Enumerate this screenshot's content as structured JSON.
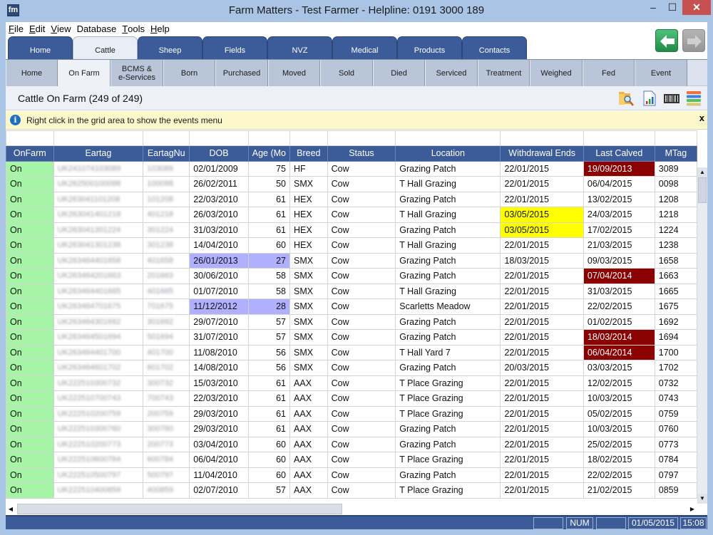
{
  "window": {
    "title": "Farm Matters - Test Farmer - Helpline: 0191 3000 189",
    "logo": "fm",
    "minimize_label": "–",
    "maximize_label": "☐",
    "close_label": "✕"
  },
  "menu": [
    {
      "label": "File",
      "accel": "F",
      "rest": "ile"
    },
    {
      "label": "Edit",
      "accel": "E",
      "rest": "dit"
    },
    {
      "label": "View",
      "accel": "V",
      "rest": "iew"
    },
    {
      "label": "Database",
      "accel": "",
      "rest": "Database"
    },
    {
      "label": "Tools",
      "accel": "T",
      "rest": "ools"
    },
    {
      "label": "Help",
      "accel": "H",
      "rest": "elp"
    }
  ],
  "main_tabs": [
    {
      "label": "Home",
      "active": false
    },
    {
      "label": "Cattle",
      "active": true
    },
    {
      "label": "Sheep",
      "active": false
    },
    {
      "label": "Fields",
      "active": false
    },
    {
      "label": "NVZ",
      "active": false
    },
    {
      "label": "Medical",
      "active": false
    },
    {
      "label": "Products",
      "active": false
    },
    {
      "label": "Contacts",
      "active": false
    }
  ],
  "nav": {
    "back_icon": "arrow-left-icon",
    "forward_icon": "arrow-right-icon"
  },
  "sub_tabs": [
    {
      "label": "Home",
      "active": false
    },
    {
      "label": "On Farm",
      "active": true
    },
    {
      "label": "BCMS &\ne-Services",
      "active": false
    },
    {
      "label": "Born",
      "active": false
    },
    {
      "label": "Purchased",
      "active": false
    },
    {
      "label": "Moved",
      "active": false
    },
    {
      "label": "Sold",
      "active": false
    },
    {
      "label": "Died",
      "active": false
    },
    {
      "label": "Serviced",
      "active": false
    },
    {
      "label": "Treatment",
      "active": false
    },
    {
      "label": "Weighed",
      "active": false
    },
    {
      "label": "Fed",
      "active": false
    },
    {
      "label": "Event",
      "active": false
    }
  ],
  "page": {
    "title": "Cattle On Farm (249 of 249)",
    "toolbar_icons": [
      "search-folder-icon",
      "report-chart-icon",
      "barcode-icon",
      "columns-list-icon"
    ]
  },
  "info": {
    "message": "Right click in the grid area to show the events menu",
    "close_label": "x"
  },
  "grid": {
    "columns": [
      "OnFarm",
      "Eartag",
      "EartagNu",
      "DOB",
      "Age (Mo",
      "Breed",
      "Status",
      "Location",
      "Withdrawal Ends",
      "Last Calved",
      "MTag"
    ],
    "rows": [
      {
        "onfarm": "On",
        "eartag": "UK241074103089",
        "eartagnu": "103089",
        "dob": "02/01/2009",
        "age": "75",
        "breed": "HF",
        "status": "Cow",
        "location": "Grazing Patch",
        "withdrawal": "22/01/2015",
        "calved": "19/09/2013",
        "mtag": "3089",
        "hl_dob": "",
        "hl_withdrawal": "",
        "hl_calved": "red"
      },
      {
        "onfarm": "On",
        "eartag": "UK262500100098",
        "eartagnu": "100098",
        "dob": "26/02/2011",
        "age": "50",
        "breed": "SMX",
        "status": "Cow",
        "location": "T Hall Grazing",
        "withdrawal": "22/01/2015",
        "calved": "06/04/2015",
        "mtag": "0098",
        "hl_dob": "",
        "hl_withdrawal": "",
        "hl_calved": ""
      },
      {
        "onfarm": "On",
        "eartag": "UK263041101208",
        "eartagnu": "101208",
        "dob": "22/03/2010",
        "age": "61",
        "breed": "HEX",
        "status": "Cow",
        "location": "Grazing Patch",
        "withdrawal": "22/01/2015",
        "calved": "13/02/2015",
        "mtag": "1208",
        "hl_dob": "",
        "hl_withdrawal": "",
        "hl_calved": ""
      },
      {
        "onfarm": "On",
        "eartag": "UK263041401218",
        "eartagnu": "401218",
        "dob": "26/03/2010",
        "age": "61",
        "breed": "HEX",
        "status": "Cow",
        "location": "T Hall Grazing",
        "withdrawal": "03/05/2015",
        "calved": "24/03/2015",
        "mtag": "1218",
        "hl_dob": "",
        "hl_withdrawal": "yellow",
        "hl_calved": ""
      },
      {
        "onfarm": "On",
        "eartag": "UK263041301224",
        "eartagnu": "301224",
        "dob": "31/03/2010",
        "age": "61",
        "breed": "HEX",
        "status": "Cow",
        "location": "Grazing Patch",
        "withdrawal": "03/05/2015",
        "calved": "17/02/2015",
        "mtag": "1224",
        "hl_dob": "",
        "hl_withdrawal": "yellow",
        "hl_calved": ""
      },
      {
        "onfarm": "On",
        "eartag": "UK263041301238",
        "eartagnu": "301238",
        "dob": "14/04/2010",
        "age": "60",
        "breed": "HEX",
        "status": "Cow",
        "location": "T Hall Grazing",
        "withdrawal": "22/01/2015",
        "calved": "21/03/2015",
        "mtag": "1238",
        "hl_dob": "",
        "hl_withdrawal": "",
        "hl_calved": ""
      },
      {
        "onfarm": "On",
        "eartag": "UK263464401658",
        "eartagnu": "401658",
        "dob": "26/01/2013",
        "age": "27",
        "breed": "SMX",
        "status": "Cow",
        "location": "Grazing Patch",
        "withdrawal": "18/03/2015",
        "calved": "09/03/2015",
        "mtag": "1658",
        "hl_dob": "purple",
        "hl_withdrawal": "",
        "hl_calved": ""
      },
      {
        "onfarm": "On",
        "eartag": "UK263464201663",
        "eartagnu": "201663",
        "dob": "30/06/2010",
        "age": "58",
        "breed": "SMX",
        "status": "Cow",
        "location": "Grazing Patch",
        "withdrawal": "22/01/2015",
        "calved": "07/04/2014",
        "mtag": "1663",
        "hl_dob": "",
        "hl_withdrawal": "",
        "hl_calved": "red"
      },
      {
        "onfarm": "On",
        "eartag": "UK263464401665",
        "eartagnu": "401665",
        "dob": "01/07/2010",
        "age": "58",
        "breed": "SMX",
        "status": "Cow",
        "location": "T Hall Grazing",
        "withdrawal": "22/01/2015",
        "calved": "31/03/2015",
        "mtag": "1665",
        "hl_dob": "",
        "hl_withdrawal": "",
        "hl_calved": ""
      },
      {
        "onfarm": "On",
        "eartag": "UK263464701675",
        "eartagnu": "701675",
        "dob": "11/12/2012",
        "age": "28",
        "breed": "SMX",
        "status": "Cow",
        "location": "Scarletts Meadow",
        "withdrawal": "22/01/2015",
        "calved": "22/02/2015",
        "mtag": "1675",
        "hl_dob": "purple",
        "hl_withdrawal": "",
        "hl_calved": ""
      },
      {
        "onfarm": "On",
        "eartag": "UK263464301692",
        "eartagnu": "301692",
        "dob": "29/07/2010",
        "age": "57",
        "breed": "SMX",
        "status": "Cow",
        "location": "Grazing Patch",
        "withdrawal": "22/01/2015",
        "calved": "01/02/2015",
        "mtag": "1692",
        "hl_dob": "",
        "hl_withdrawal": "",
        "hl_calved": ""
      },
      {
        "onfarm": "On",
        "eartag": "UK263464501694",
        "eartagnu": "501694",
        "dob": "31/07/2010",
        "age": "57",
        "breed": "SMX",
        "status": "Cow",
        "location": "Grazing Patch",
        "withdrawal": "22/01/2015",
        "calved": "18/03/2014",
        "mtag": "1694",
        "hl_dob": "",
        "hl_withdrawal": "",
        "hl_calved": "red"
      },
      {
        "onfarm": "On",
        "eartag": "UK263464401700",
        "eartagnu": "401700",
        "dob": "11/08/2010",
        "age": "56",
        "breed": "SMX",
        "status": "Cow",
        "location": "T Hall Yard 7",
        "withdrawal": "22/01/2015",
        "calved": "06/04/2014",
        "mtag": "1700",
        "hl_dob": "",
        "hl_withdrawal": "",
        "hl_calved": "red"
      },
      {
        "onfarm": "On",
        "eartag": "UK263464601702",
        "eartagnu": "601702",
        "dob": "14/08/2010",
        "age": "56",
        "breed": "SMX",
        "status": "Cow",
        "location": "Grazing Patch",
        "withdrawal": "20/03/2015",
        "calved": "03/03/2015",
        "mtag": "1702",
        "hl_dob": "",
        "hl_withdrawal": "",
        "hl_calved": ""
      },
      {
        "onfarm": "On",
        "eartag": "UK222510300732",
        "eartagnu": "300732",
        "dob": "15/03/2010",
        "age": "61",
        "breed": "AAX",
        "status": "Cow",
        "location": "T Place Grazing",
        "withdrawal": "22/01/2015",
        "calved": "12/02/2015",
        "mtag": "0732",
        "hl_dob": "",
        "hl_withdrawal": "",
        "hl_calved": ""
      },
      {
        "onfarm": "On",
        "eartag": "UK222510700743",
        "eartagnu": "700743",
        "dob": "22/03/2010",
        "age": "61",
        "breed": "AAX",
        "status": "Cow",
        "location": "T Place Grazing",
        "withdrawal": "22/01/2015",
        "calved": "10/03/2015",
        "mtag": "0743",
        "hl_dob": "",
        "hl_withdrawal": "",
        "hl_calved": ""
      },
      {
        "onfarm": "On",
        "eartag": "UK222510200759",
        "eartagnu": "200759",
        "dob": "29/03/2010",
        "age": "61",
        "breed": "AAX",
        "status": "Cow",
        "location": "T Place Grazing",
        "withdrawal": "22/01/2015",
        "calved": "05/02/2015",
        "mtag": "0759",
        "hl_dob": "",
        "hl_withdrawal": "",
        "hl_calved": ""
      },
      {
        "onfarm": "On",
        "eartag": "UK222510300760",
        "eartagnu": "300760",
        "dob": "29/03/2010",
        "age": "61",
        "breed": "AAX",
        "status": "Cow",
        "location": "Grazing Patch",
        "withdrawal": "22/01/2015",
        "calved": "10/03/2015",
        "mtag": "0760",
        "hl_dob": "",
        "hl_withdrawal": "",
        "hl_calved": ""
      },
      {
        "onfarm": "On",
        "eartag": "UK222510200773",
        "eartagnu": "200773",
        "dob": "03/04/2010",
        "age": "60",
        "breed": "AAX",
        "status": "Cow",
        "location": "Grazing Patch",
        "withdrawal": "22/01/2015",
        "calved": "25/02/2015",
        "mtag": "0773",
        "hl_dob": "",
        "hl_withdrawal": "",
        "hl_calved": ""
      },
      {
        "onfarm": "On",
        "eartag": "UK222510600784",
        "eartagnu": "600784",
        "dob": "06/04/2010",
        "age": "60",
        "breed": "AAX",
        "status": "Cow",
        "location": "T Place Grazing",
        "withdrawal": "22/01/2015",
        "calved": "18/02/2015",
        "mtag": "0784",
        "hl_dob": "",
        "hl_withdrawal": "",
        "hl_calved": ""
      },
      {
        "onfarm": "On",
        "eartag": "UK222510500797",
        "eartagnu": "500797",
        "dob": "11/04/2010",
        "age": "60",
        "breed": "AAX",
        "status": "Cow",
        "location": "Grazing Patch",
        "withdrawal": "22/01/2015",
        "calved": "22/02/2015",
        "mtag": "0797",
        "hl_dob": "",
        "hl_withdrawal": "",
        "hl_calved": ""
      },
      {
        "onfarm": "On",
        "eartag": "UK222510400859",
        "eartagnu": "400859",
        "dob": "02/07/2010",
        "age": "57",
        "breed": "AAX",
        "status": "Cow",
        "location": "T Place Grazing",
        "withdrawal": "22/01/2015",
        "calved": "21/02/2015",
        "mtag": "0859",
        "hl_dob": "",
        "hl_withdrawal": "",
        "hl_calved": ""
      }
    ]
  },
  "statusbar": {
    "num": "NUM",
    "date": "01/05/2015",
    "time": "15:08"
  },
  "colors": {
    "accent": "#3c5b99",
    "onfarm_green": "#a6f5a6",
    "highlight_purple": "#b0b0ff",
    "highlight_yellow": "#ffff00",
    "highlight_red": "#8b0000"
  }
}
